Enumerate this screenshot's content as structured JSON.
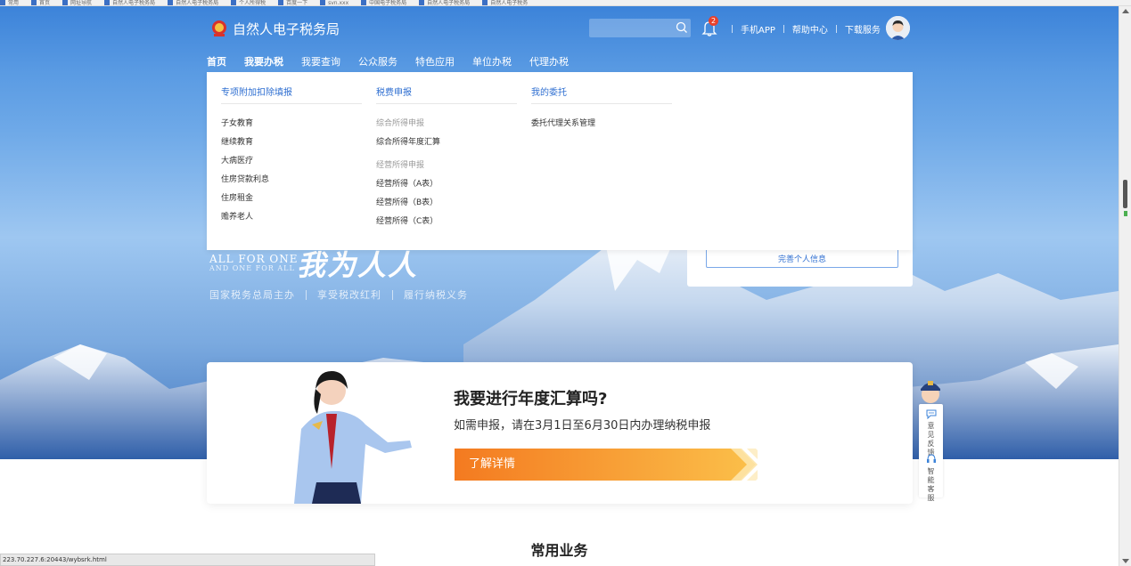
{
  "bookmarks": [
    "常用",
    "首页",
    "网址导航",
    "自然人电子税务局",
    "自然人电子税务局",
    "个人所得税",
    "百度一下",
    "svn.xxx",
    "中国电子税务局",
    "自然人电子税务局",
    "自然人电子税务"
  ],
  "header": {
    "site_title": "自然人电子税务局",
    "search_placeholder": "",
    "notification_count": "2",
    "links": [
      "手机APP",
      "帮助中心",
      "下载服务"
    ]
  },
  "nav": {
    "items": [
      "首页",
      "我要办税",
      "我要查询",
      "公众服务",
      "特色应用",
      "单位办税",
      "代理办税"
    ],
    "active_index": 1
  },
  "menu": {
    "col1": {
      "heading": "专项附加扣除填报",
      "items": [
        "子女教育",
        "继续教育",
        "大病医疗",
        "住房贷款利息",
        "住房租金",
        "赡养老人"
      ]
    },
    "col2": {
      "heading": "税费申报",
      "group1": "综合所得申报",
      "items1": [
        "综合所得年度汇算"
      ],
      "group2": "经营所得申报",
      "items2": [
        "经营所得（A表）",
        "经营所得（B表）",
        "经营所得（C表）"
      ]
    },
    "col3": {
      "heading": "我的委托",
      "items": [
        "委托代理关系管理"
      ]
    }
  },
  "hero": {
    "slogan_en_1": "ALL FOR ONE",
    "slogan_en_2": "AND ONE FOR ALL",
    "slogan_cn": "我为人人",
    "sub_items": [
      "国家税务总局主办",
      "享受税改红利",
      "履行纳税义务"
    ]
  },
  "profile_card": {
    "button_label": "完善个人信息"
  },
  "banner": {
    "title": "我要进行年度汇算吗?",
    "description": "如需申报，请在3月1日至6月30日内办理纳税申报",
    "button_label": "了解详情"
  },
  "float_panel": {
    "feedback": "意见反馈",
    "service": "智能客服"
  },
  "section_title": "常用业务",
  "status_url": "223.70.227.6:20443/wybsrk.html",
  "colors": {
    "brand_blue": "#3c83d9",
    "link_blue": "#2f6fd1",
    "orange": "#f47a20",
    "badge_red": "#e8412c"
  }
}
